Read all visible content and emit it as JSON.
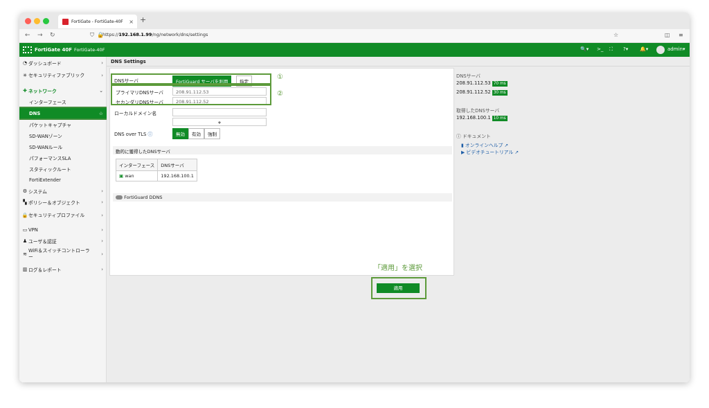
{
  "browser": {
    "tab_title": "FortiGate - FortiGate-40F",
    "url_host": "192.168.1.99",
    "url_prefix": "https://",
    "url_path": "/ng/network/dns/settings"
  },
  "header": {
    "product": "FortiGate 40F",
    "hostname": "FortiGate-40F",
    "user": "admin"
  },
  "sidebar": {
    "items": [
      {
        "label": "ダッシュボード",
        "icon": "dashboard-icon"
      },
      {
        "label": "セキュリティファブリック",
        "icon": "fabric-icon"
      },
      {
        "label": "ネットワーク",
        "icon": "network-icon"
      },
      {
        "label": "インターフェース"
      },
      {
        "label": "DNS"
      },
      {
        "label": "パケットキャプチャ"
      },
      {
        "label": "SD-WANゾーン"
      },
      {
        "label": "SD-WANルール"
      },
      {
        "label": "パフォーマンスSLA"
      },
      {
        "label": "スタティックルート"
      },
      {
        "label": "FortiExtender"
      },
      {
        "label": "システム",
        "icon": "gear-icon"
      },
      {
        "label": "ポリシー＆オブジェクト",
        "icon": "policy-icon"
      },
      {
        "label": "セキュリティプロファイル",
        "icon": "lock-icon"
      },
      {
        "label": "VPN",
        "icon": "vpn-icon"
      },
      {
        "label": "ユーザ＆認証",
        "icon": "user-icon"
      },
      {
        "label": "WiFi＆スイッチコントローラー",
        "icon": "wifi-icon"
      },
      {
        "label": "ログ＆レポート",
        "icon": "chart-icon"
      }
    ]
  },
  "breadcrumb": "DNS Settings",
  "form": {
    "dns_server_label": "DNSサーバ",
    "opt_fortiguard": "FortiGuard サーバを利用",
    "opt_specify": "指定",
    "primary_label": "プライマリDNSサーバ",
    "primary_value": "208.91.112.53",
    "secondary_label": "セカンダリDNSサーバ",
    "secondary_value": "208.91.112.52",
    "local_domain_label": "ローカルドメイン名",
    "local_domain_value": "",
    "plus": "+",
    "dot_label": "DNS over TLS",
    "dot_opts": [
      "無効",
      "有効",
      "強制"
    ],
    "callout1": "①",
    "callout2": "②"
  },
  "dynamic": {
    "section_title": "動的に獲得したDNSサーバ",
    "col_interface": "インターフェース",
    "col_dns": "DNSサーバ",
    "row_interface": "wan",
    "row_dns": "192.168.100.1"
  },
  "ddns": {
    "label": "FortiGuard DDNS"
  },
  "right": {
    "dns_title": "DNSサーバ",
    "servers": [
      {
        "ip": "208.91.112.53",
        "ms": "70 ms"
      },
      {
        "ip": "208.91.112.52",
        "ms": "30 ms"
      }
    ],
    "obtained_title": "取得したDNSサーバ",
    "obtained": [
      {
        "ip": "192.168.100.1",
        "ms": "10 ms"
      }
    ],
    "doc_title": "ドキュメント",
    "help": "オンラインヘルプ",
    "video": "ビデオチュートリアル"
  },
  "instruction": "「適用」を選択",
  "apply_label": "適用",
  "colors": {
    "accent": "#108b26",
    "callout": "#5c9a3a"
  }
}
